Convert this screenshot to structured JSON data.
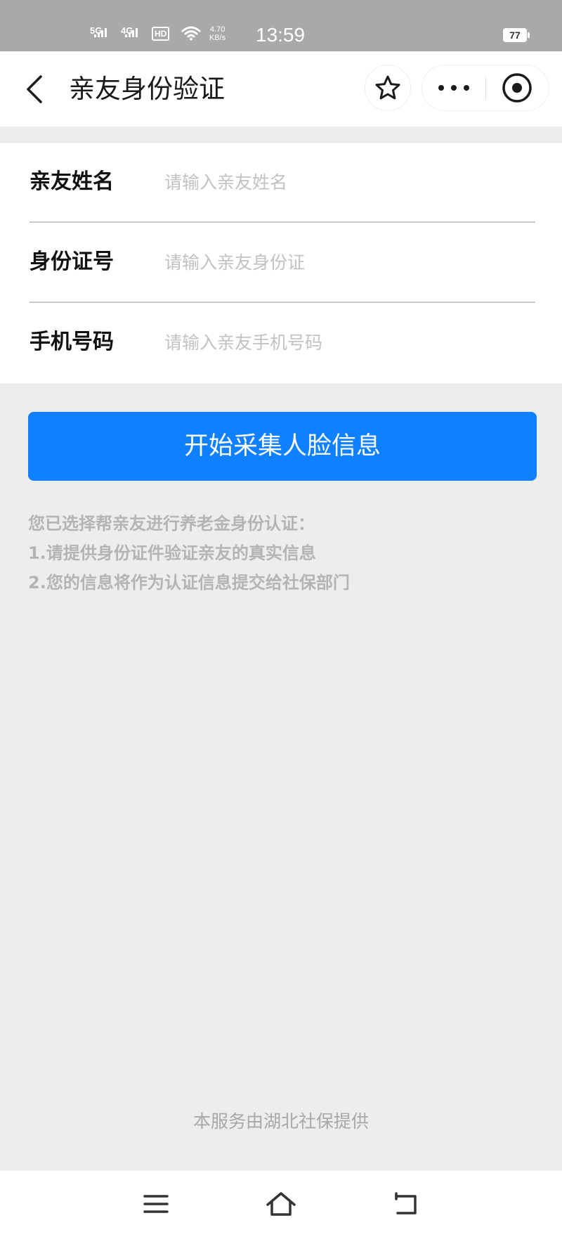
{
  "status_bar": {
    "signal_1": "5G",
    "signal_2": "4G",
    "hd_label": "HD",
    "network_speed_value": "4.70",
    "network_speed_unit": "KB/s",
    "time": "13:59",
    "battery": "77"
  },
  "header": {
    "title": "亲友身份验证"
  },
  "form": {
    "fields": [
      {
        "label": "亲友姓名",
        "placeholder": "请输入亲友姓名",
        "value": ""
      },
      {
        "label": "身份证号",
        "placeholder": "请输入亲友身份证",
        "value": ""
      },
      {
        "label": "手机号码",
        "placeholder": "请输入亲友手机号码",
        "value": ""
      }
    ]
  },
  "primary_button": {
    "label": "开始采集人脸信息"
  },
  "notes": [
    "您已选择帮亲友进行养老金身份认证：",
    "1.请提供身份证件验证亲友的真实信息",
    "2.您的信息将作为认证信息提交给社保部门"
  ],
  "footer": {
    "text": "本服务由湖北社保提供"
  },
  "colors": {
    "accent": "#0f80ff",
    "page_background": "#eceeee",
    "status_bar": "#a9a9a9",
    "hint_text": "#b4b4b4"
  },
  "icons": {
    "back": "chevron-left-icon",
    "star": "star-icon",
    "more": "more-dots-icon",
    "close": "target-circle-icon",
    "menu": "menu-lines-icon",
    "home": "home-icon",
    "back_gesture": "back-arrow-icon"
  }
}
